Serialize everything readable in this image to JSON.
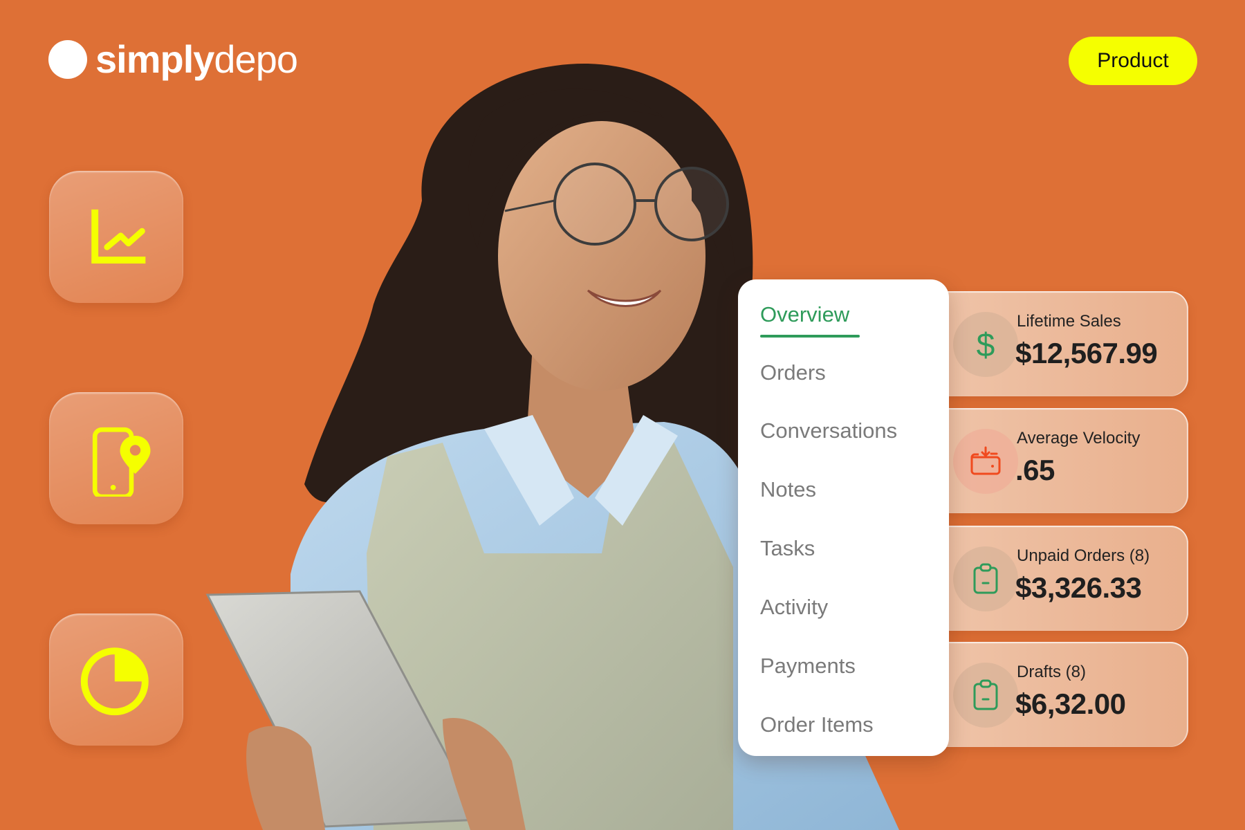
{
  "brand": {
    "name_bold": "simply",
    "name_light": "depo",
    "background_color": "#DE7036",
    "accent_yellow": "#F5FF00",
    "accent_green": "#2E9B5A",
    "accent_orange_red": "#F04A1E"
  },
  "header": {
    "badge_label": "Product"
  },
  "feature_tiles": [
    {
      "icon": "line-chart-icon"
    },
    {
      "icon": "phone-location-pin-icon"
    },
    {
      "icon": "pie-chart-icon"
    }
  ],
  "hero_image": {
    "description": "Smiling woman with curly hair and round glasses wearing an apron over a light blue shirt, holding a tablet"
  },
  "menu": {
    "items": [
      {
        "label": "Overview",
        "active": true
      },
      {
        "label": "Orders",
        "active": false
      },
      {
        "label": "Conversations",
        "active": false
      },
      {
        "label": "Notes",
        "active": false
      },
      {
        "label": "Tasks",
        "active": false
      },
      {
        "label": "Activity",
        "active": false
      },
      {
        "label": "Payments",
        "active": false
      },
      {
        "label": "Order Items",
        "active": false
      }
    ]
  },
  "stats": [
    {
      "label": "Lifetime Sales",
      "value": "$12,567.99",
      "icon": "dollar-icon"
    },
    {
      "label": "Average Velocity",
      "value": ".65",
      "icon": "wallet-download-icon"
    },
    {
      "label": "Unpaid Orders (8)",
      "value": "$3,326.33",
      "icon": "clipboard-icon"
    },
    {
      "label": "Drafts (8)",
      "value": "$6,32.00",
      "icon": "clipboard-icon"
    }
  ]
}
